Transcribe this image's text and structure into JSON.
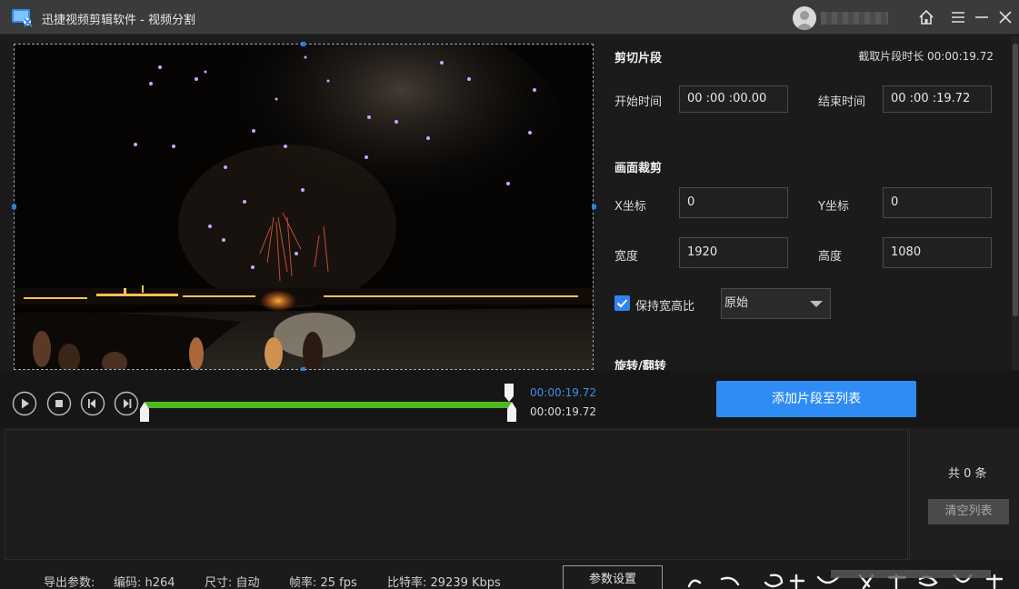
{
  "window": {
    "title": "迅捷视频剪辑软件 - 视频分割",
    "controls": [
      "home-icon",
      "menu-icon",
      "minimize-icon",
      "close-icon"
    ],
    "accent_color": "#2f8cf4"
  },
  "cut": {
    "section_title": "剪切片段",
    "duration_label": "截取片段时长 00:00:19.72",
    "start_label": "开始时间",
    "start_value": "00 :00 :00.00",
    "end_label": "结束时间",
    "end_value": "00 :00 :19.72"
  },
  "crop": {
    "section_title": "画面裁剪",
    "x_label": "X坐标",
    "x_value": "0",
    "y_label": "Y坐标",
    "y_value": "0",
    "width_label": "宽度",
    "width_value": "1920",
    "height_label": "高度",
    "height_value": "1080",
    "keep_ratio_label": "保持宽高比",
    "keep_ratio_checked": true,
    "ratio_selected": "原始"
  },
  "rotate": {
    "section_title": "旋转/翻转"
  },
  "transport": {
    "buttons": [
      "play-icon",
      "stop-icon",
      "prev-frame-icon",
      "next-frame-icon"
    ],
    "progress_fraction": 1.0,
    "current_time": "00:00:19.72",
    "total_time": "00:00:19.72",
    "add_button": "添加片段至列表",
    "progress_color": "#4fb81f"
  },
  "list": {
    "count_text": "共 0 条",
    "clear_button": "清空列表"
  },
  "export": {
    "label": "导出参数:",
    "codec": "编码: h264",
    "size": "尺寸: 自动",
    "fps": "帧率: 25 fps",
    "bitrate": "比特率: 29239 Kbps",
    "settings_button": "参数设置"
  }
}
